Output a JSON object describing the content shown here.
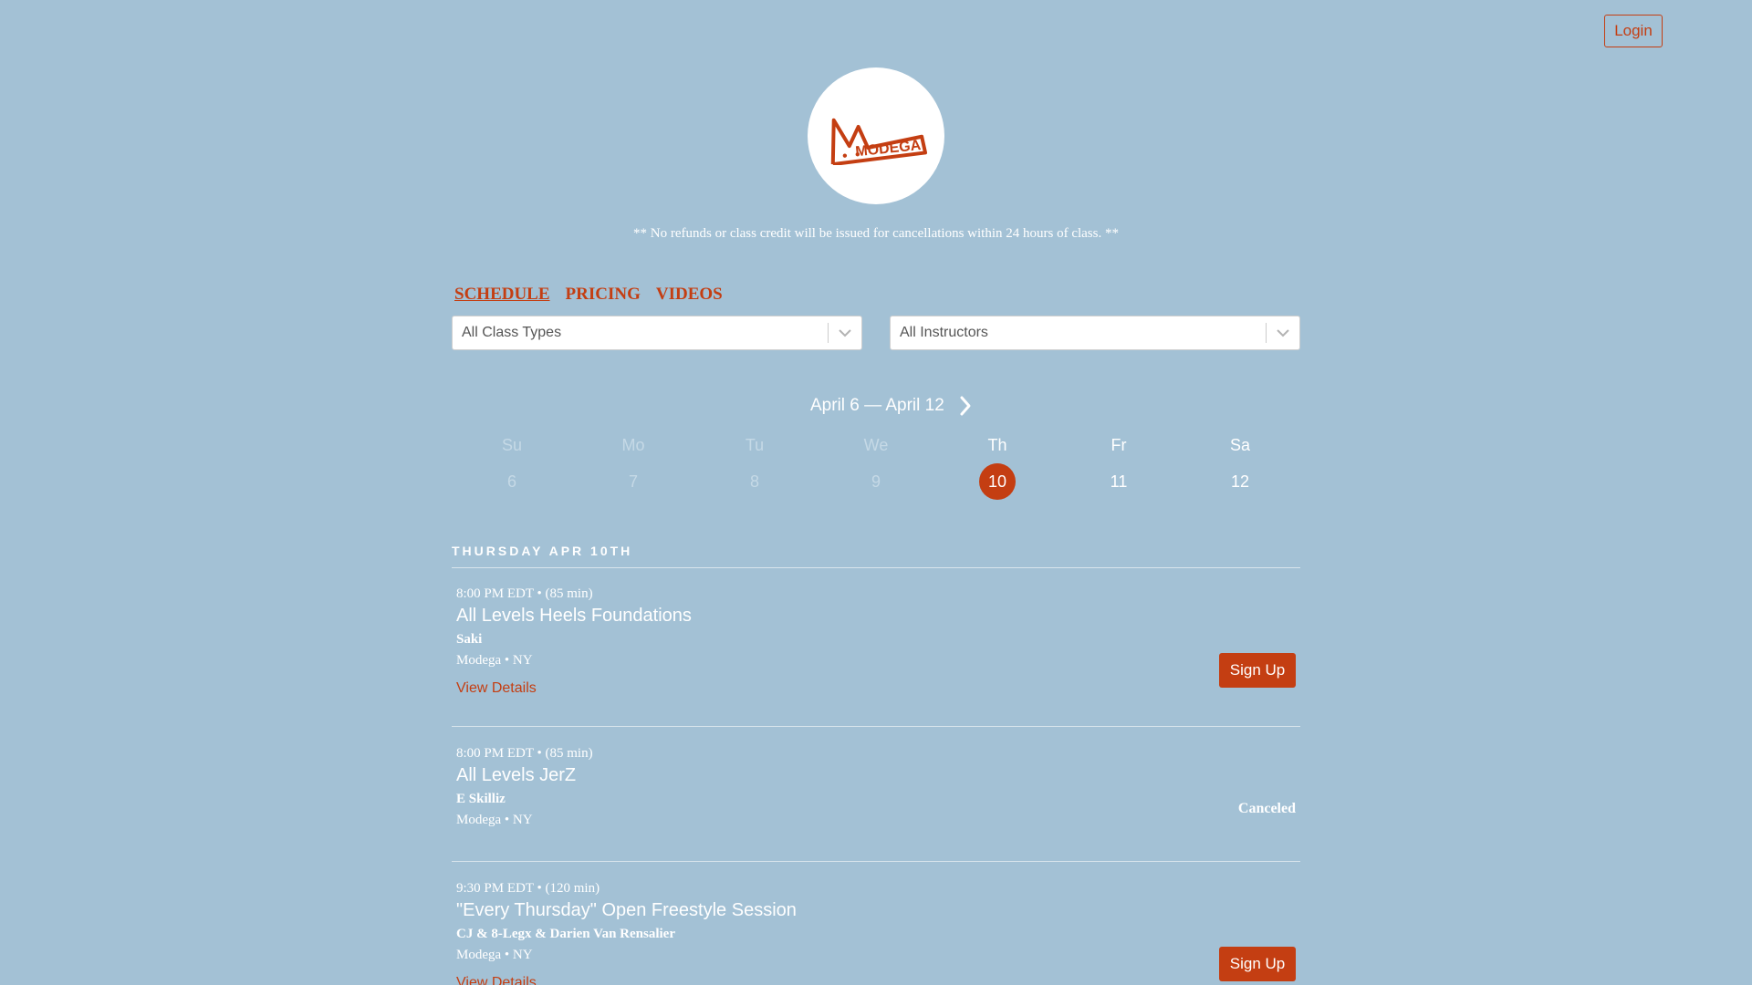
{
  "header": {
    "login_label": "Login",
    "logo_text": "MODEGA"
  },
  "notice": "** No refunds or class credit will be issued for cancellations within 24 hours of class. **",
  "tabs": [
    {
      "label": "SCHEDULE",
      "active": true
    },
    {
      "label": "PRICING",
      "active": false
    },
    {
      "label": "VIDEOS",
      "active": false
    }
  ],
  "filters": {
    "class_types": "All Class Types",
    "instructors": "All Instructors"
  },
  "week": {
    "range": "April 6 — April 12",
    "days": [
      {
        "name": "Su",
        "date": "6",
        "state": "past"
      },
      {
        "name": "Mo",
        "date": "7",
        "state": "past"
      },
      {
        "name": "Tu",
        "date": "8",
        "state": "past"
      },
      {
        "name": "We",
        "date": "9",
        "state": "past"
      },
      {
        "name": "Th",
        "date": "10",
        "state": "selected"
      },
      {
        "name": "Fr",
        "date": "11",
        "state": "future"
      },
      {
        "name": "Sa",
        "date": "12",
        "state": "future"
      }
    ]
  },
  "schedule": {
    "date_heading": "THURSDAY APR 10TH",
    "classes": [
      {
        "time": "8:00 PM EDT • (85 min)",
        "title": "All Levels Heels Foundations",
        "instructor": "Saki",
        "location": "Modega • NY",
        "details_label": "View Details",
        "action": "Sign Up"
      },
      {
        "time": "8:00 PM EDT • (85 min)",
        "title": "All Levels JerZ",
        "instructor": "E Skilliz",
        "location": "Modega • NY",
        "status": "Canceled"
      },
      {
        "time": "9:30 PM EDT • (120 min)",
        "title": "\"Every Thursday\" Open Freestyle Session",
        "instructor": "CJ & 8-Legx & Darien Van Rensalier",
        "location": "Modega • NY",
        "details_label": "View Details",
        "action": "Sign Up"
      }
    ]
  },
  "colors": {
    "background": "#a3c1d5",
    "accent": "#c43e12"
  }
}
